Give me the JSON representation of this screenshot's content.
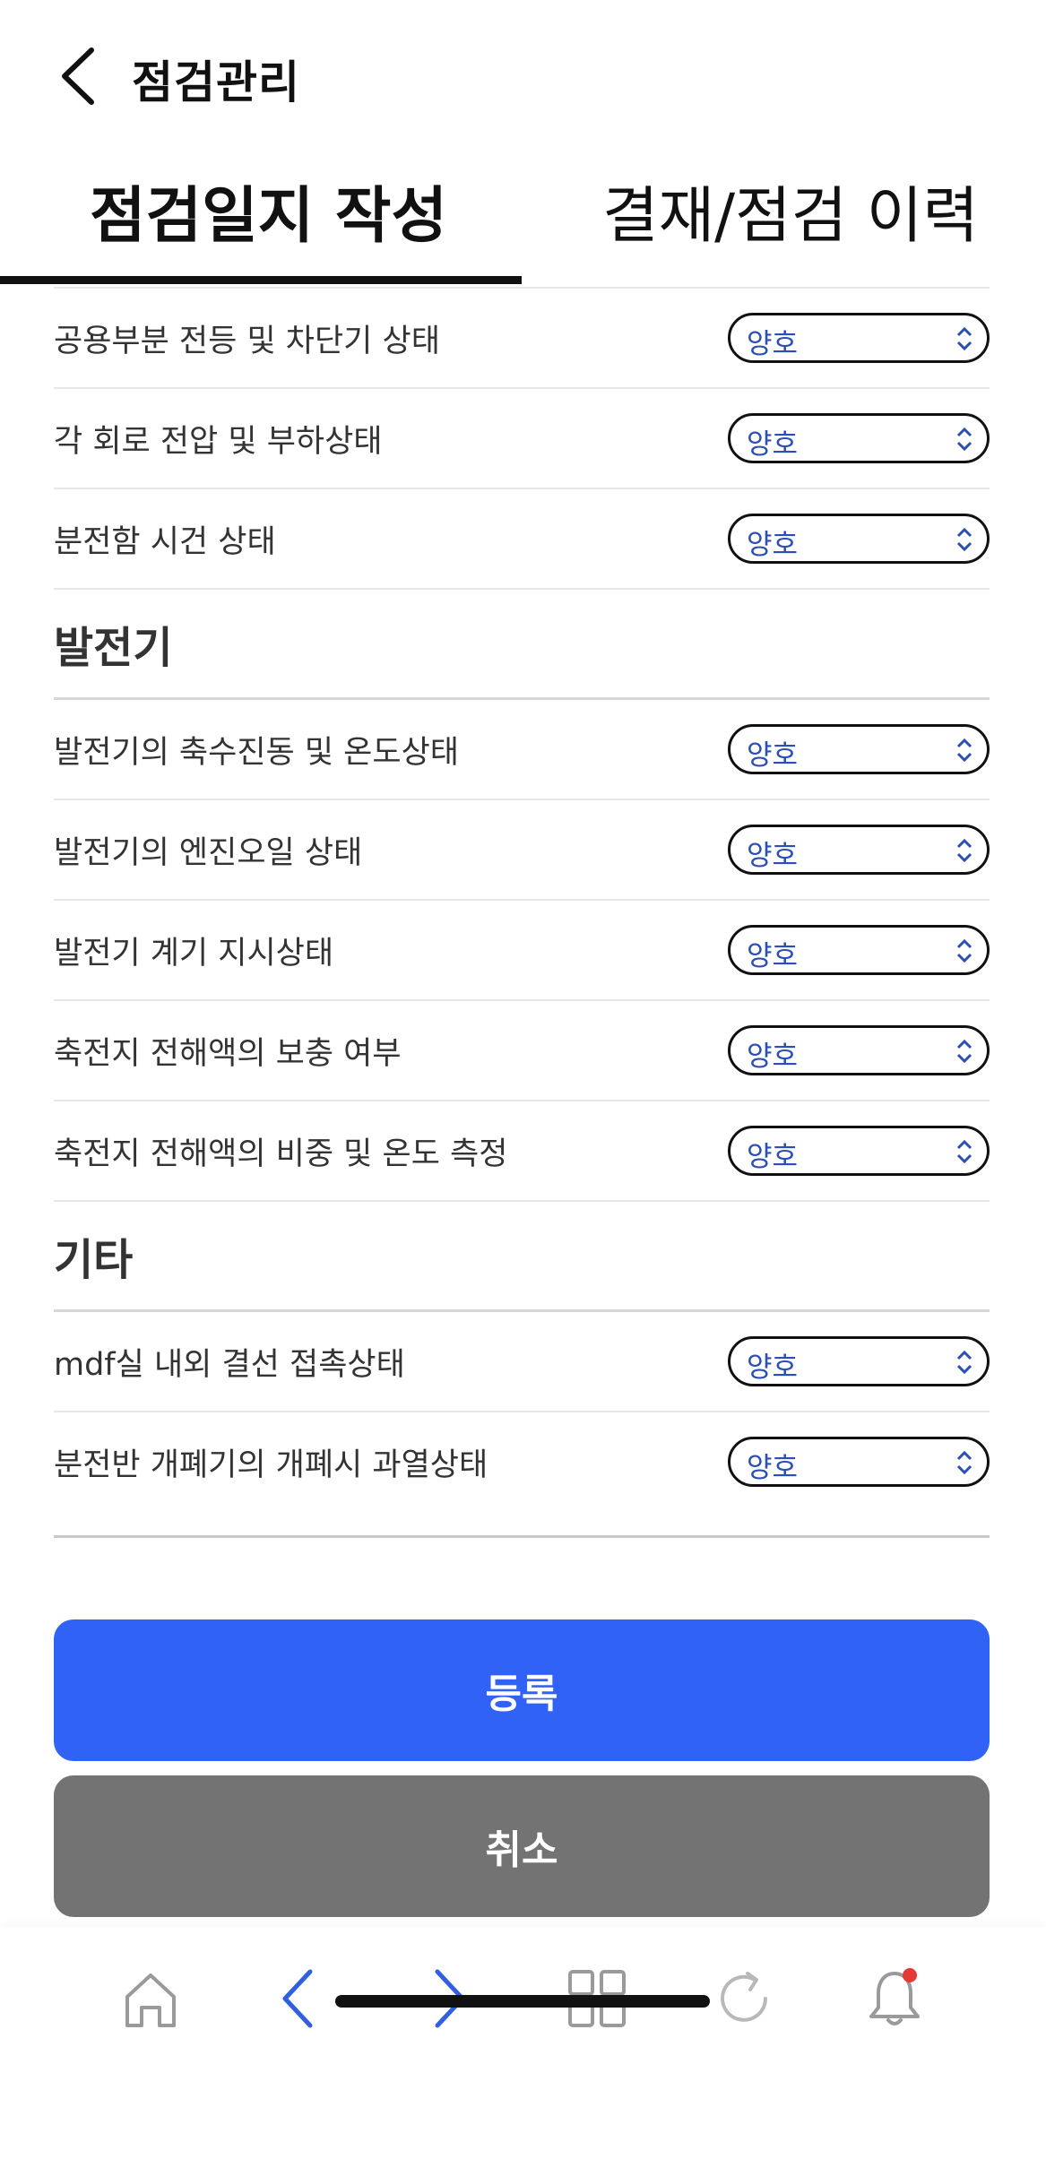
{
  "header": {
    "title": "점검관리"
  },
  "tabs": [
    {
      "label": "점검일지 작성",
      "active": true
    },
    {
      "label": "결재/점검 이력",
      "active": false
    }
  ],
  "status_option": "양호",
  "group1": {
    "items": [
      {
        "label": "공용부분 전등 및 차단기 상태",
        "value": "양호"
      },
      {
        "label": "각 회로 전압 및 부하상태",
        "value": "양호"
      },
      {
        "label": "분전함 시건 상태",
        "value": "양호"
      }
    ]
  },
  "sections": [
    {
      "title": "발전기",
      "items": [
        {
          "label": "발전기의 축수진동 및 온도상태",
          "value": "양호"
        },
        {
          "label": "발전기의 엔진오일 상태",
          "value": "양호"
        },
        {
          "label": "발전기 계기 지시상태",
          "value": "양호"
        },
        {
          "label": "축전지 전해액의 보충 여부",
          "value": "양호"
        },
        {
          "label": "축전지 전해액의 비중 및 온도 측정",
          "value": "양호"
        }
      ]
    },
    {
      "title": "기타",
      "items": [
        {
          "label": "mdf실 내외 결선 접촉상태",
          "value": "양호"
        },
        {
          "label": "분전반 개폐기의 개폐시 과열상태",
          "value": "양호"
        }
      ]
    }
  ],
  "buttons": {
    "register": "등록",
    "cancel": "취소"
  },
  "colors": {
    "primary": "#2f62f5",
    "secondary": "#737373",
    "select_text": "#2c4fb6",
    "notification_dot": "#e53935"
  },
  "toolbar": {
    "icons": [
      "home-icon",
      "back-icon",
      "forward-icon",
      "grid-icon",
      "refresh-icon",
      "bell-icon"
    ]
  }
}
